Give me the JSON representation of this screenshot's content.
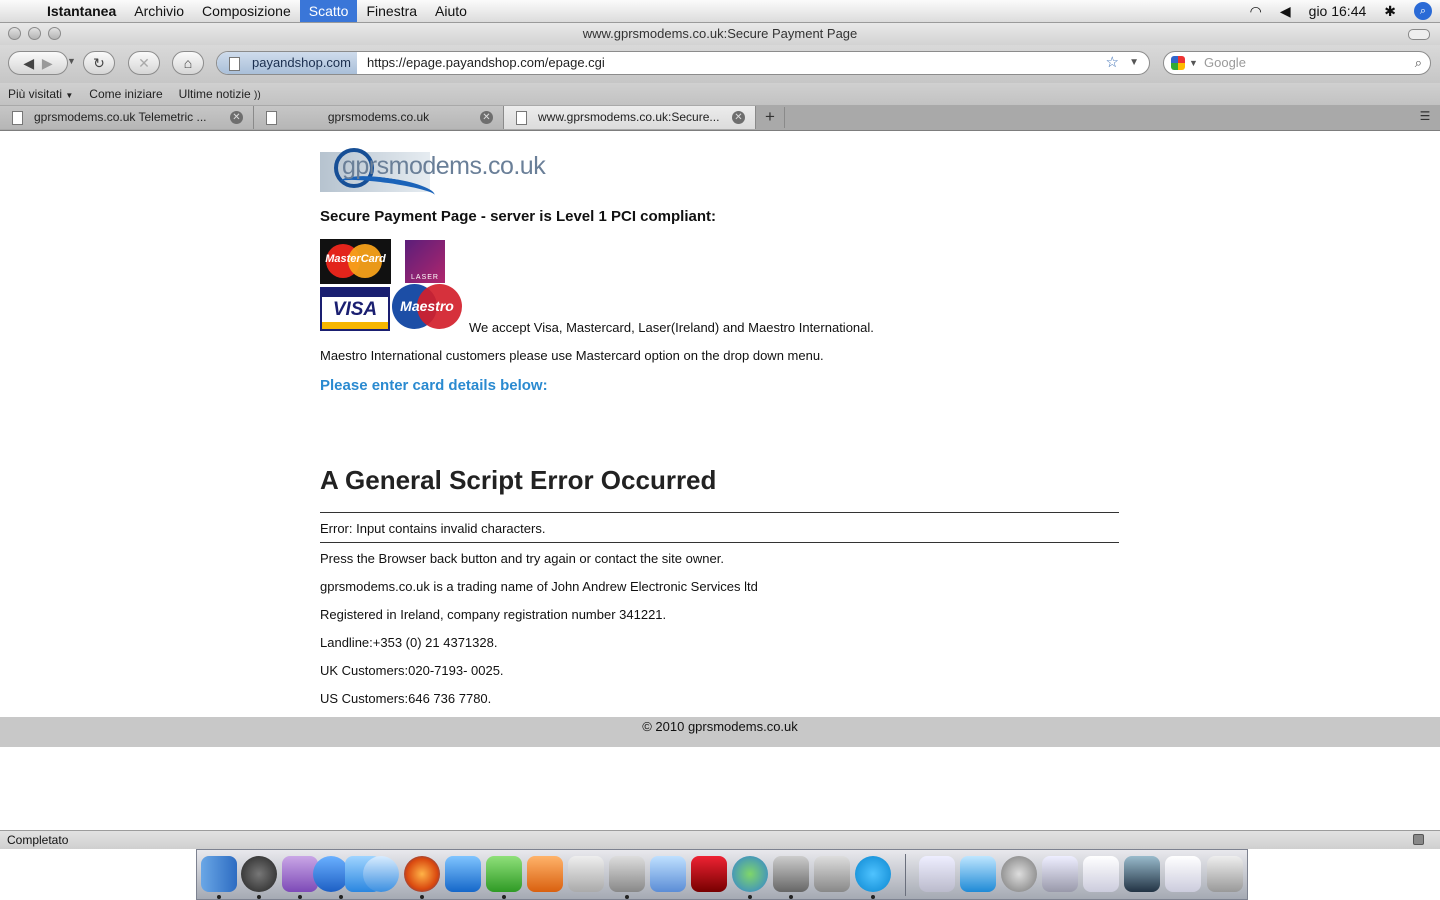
{
  "menubar": {
    "items": [
      "Istantanea",
      "Archivio",
      "Composizione",
      "Scatto",
      "Finestra",
      "Aiuto"
    ],
    "clock": "gio 16:44"
  },
  "window": {
    "title": "www.gprsmodems.co.uk:Secure Payment Page"
  },
  "toolbar": {
    "site_identity": "payandshop.com",
    "url": "https://epage.payandshop.com/epage.cgi",
    "search_placeholder": "Google"
  },
  "bookmarks": [
    "Più visitati",
    "Come iniziare",
    "Ultime notizie"
  ],
  "tabs": [
    {
      "label": "gprsmodems.co.uk Telemetric ..."
    },
    {
      "label": "gprsmodems.co.uk"
    },
    {
      "label": "www.gprsmodems.co.uk:Secure..."
    }
  ],
  "page": {
    "logo_text": "gprsmodems.co.uk",
    "secure_heading": "Secure Payment Page - server is Level 1 PCI compliant:",
    "cards": {
      "mastercard": "MasterCard",
      "laser": "LASER",
      "visa": "VISA",
      "maestro": "Maestro"
    },
    "accept_text": "We accept Visa, Mastercard, Laser(Ireland) and Maestro International.",
    "maestro_note": "Maestro International customers please use Mastercard option on the drop down menu.",
    "enter_details": "Please enter card details below:",
    "error_title": "A General Script Error Occurred",
    "error_message": "Error: Input contains invalid characters.",
    "info_lines": [
      "Press the Browser back button and try again or contact the site owner.",
      "gprsmodems.co.uk is a trading name of John Andrew Electronic Services ltd",
      "Registered in Ireland, company registration number 341221.",
      "Landline:+353 (0) 21 4371328.",
      "UK Customers:020-7193- 0025.",
      "US Customers:646 736 7780."
    ],
    "footer": "© 2010 gprsmodems.co.uk"
  },
  "status": {
    "text": "Completato"
  },
  "colors": {
    "menu_highlight": "#3a76d8",
    "link_blue": "#2a8ad0",
    "footer_bg": "#c8c8c8"
  }
}
